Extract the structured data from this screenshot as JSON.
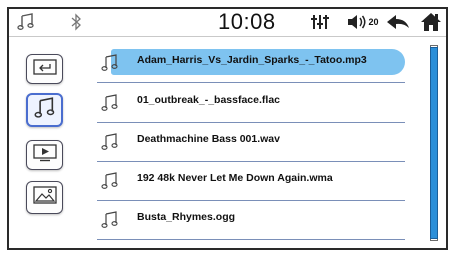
{
  "status_bar": {
    "clock": "10:08",
    "volume_level": "20",
    "icons": [
      "music-note-icon",
      "bluetooth-icon",
      "equalizer-icon",
      "volume-icon",
      "back-icon",
      "home-icon"
    ]
  },
  "sidebar": {
    "items": [
      {
        "icon": "folder-back-icon",
        "active": false
      },
      {
        "icon": "music-note-icon",
        "active": true
      },
      {
        "icon": "video-icon",
        "active": false
      },
      {
        "icon": "image-icon",
        "active": false
      }
    ]
  },
  "file_list": {
    "items": [
      {
        "label": "Adam_Harris_Vs_Jardin_Sparks_-_Tatoo.mp3",
        "selected": true
      },
      {
        "label": "01_outbreak_-_bassface.flac",
        "selected": false
      },
      {
        "label": "Deathmachine Bass 001.wav",
        "selected": false
      },
      {
        "label": "192 48k Never Let Me Down Again.wma",
        "selected": false
      },
      {
        "label": "Busta_Rhymes.ogg",
        "selected": false
      }
    ]
  },
  "colors": {
    "selection": "#7ec3f0",
    "scroll_thumb": "#2b8fd9",
    "active_button_border": "#4a6dcf"
  }
}
